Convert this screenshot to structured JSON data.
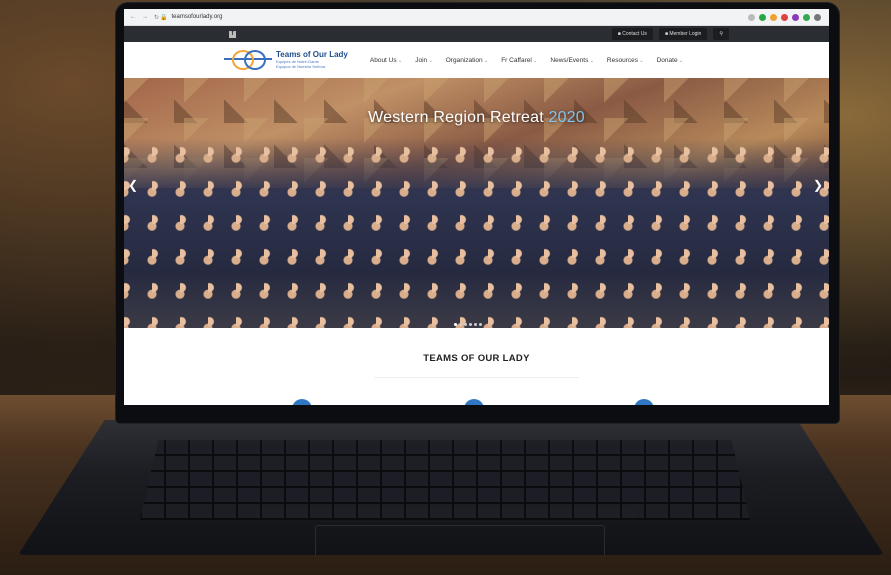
{
  "browser": {
    "url": "teamsofourlady.org",
    "nav_icons": [
      "back-icon",
      "forward-icon",
      "reload-icon"
    ],
    "extension_colors": [
      "#27a745",
      "#f0a030",
      "#e04040",
      "#8a3ab9",
      "#34a853",
      "#777777"
    ]
  },
  "topbar": {
    "facebook_label": "f",
    "contact_label": "Contact Us",
    "login_label": "Member Login",
    "search_icon": "search-icon"
  },
  "header": {
    "logo_title": "Teams of Our Lady",
    "logo_sub1": "Equipes de Notre-Dame",
    "logo_sub2": "Equipos de Nuestra Señora",
    "menu": [
      "About Us",
      "Join",
      "Organization",
      "Fr Caffarel",
      "News/Events",
      "Resources",
      "Donate"
    ]
  },
  "hero": {
    "title": "Western Region Retreat",
    "year": "2020",
    "prev_icon": "chevron-left-icon",
    "next_icon": "chevron-right-icon",
    "slide_count": 6,
    "active_slide": 1
  },
  "section": {
    "title": "TEAMS OF OUR LADY"
  },
  "colors": {
    "brand_blue": "#2f78c4",
    "logo_orange": "#f1a63a",
    "topbar": "#2a2d31"
  }
}
